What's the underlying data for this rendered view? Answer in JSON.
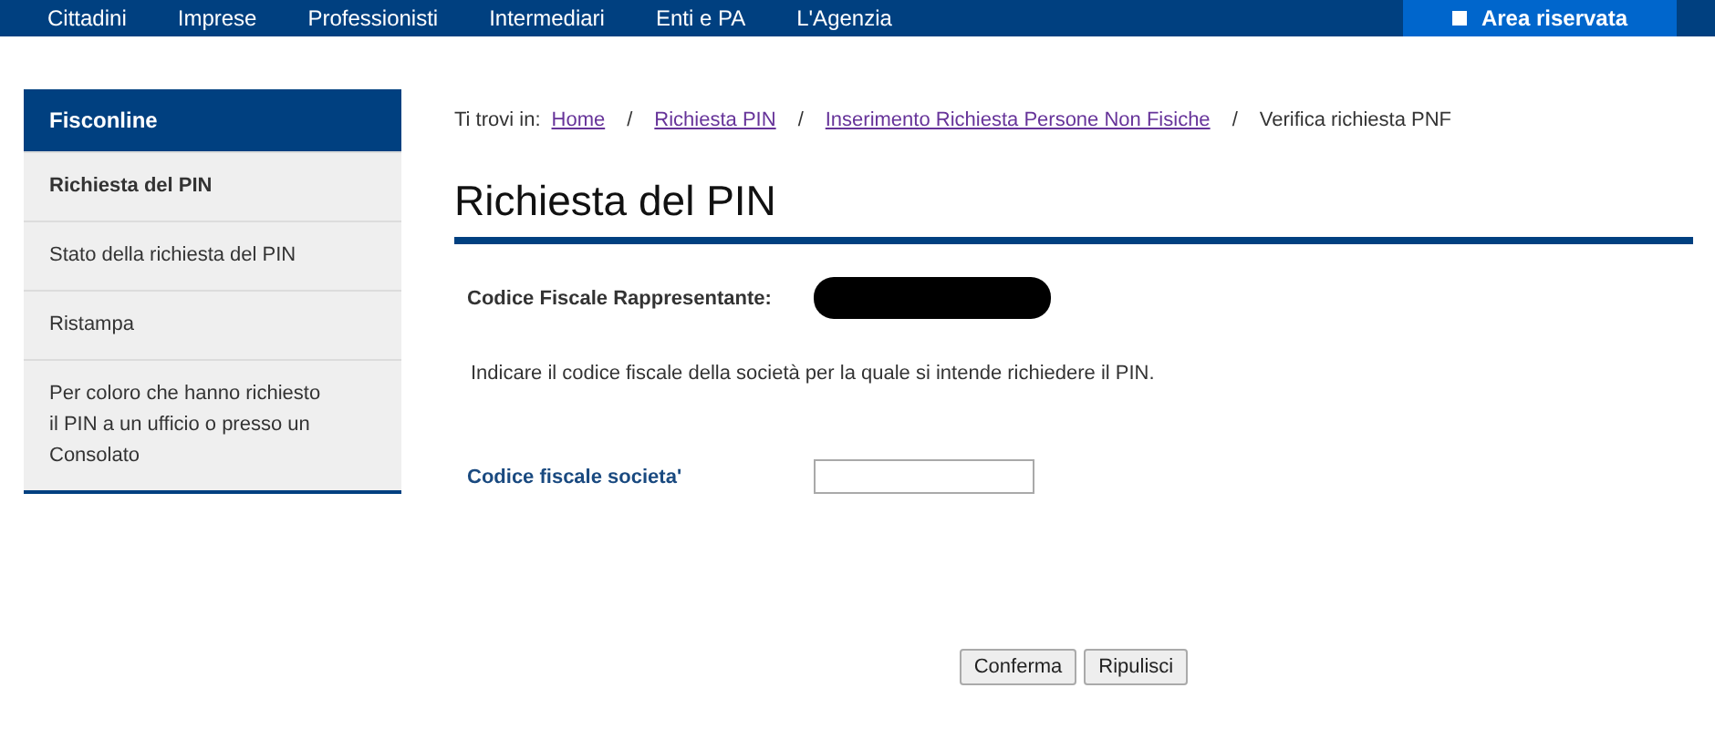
{
  "top_nav": {
    "items": [
      "Cittadini",
      "Imprese",
      "Professionisti",
      "Intermediari",
      "Enti e PA",
      "L'Agenzia"
    ],
    "reserved_button": "Area riservata"
  },
  "sidebar": {
    "title": "Fisconline",
    "items": [
      {
        "label": "Richiesta del PIN",
        "selected": true
      },
      {
        "label": "Stato della richiesta del PIN",
        "selected": false
      },
      {
        "label": "Ristampa",
        "selected": false
      },
      {
        "label": "Per coloro che hanno richiesto il PIN a un ufficio o presso un Consolato",
        "selected": false
      }
    ]
  },
  "breadcrumb": {
    "prefix": "Ti trovi in:",
    "links": [
      "Home",
      "Richiesta PIN",
      "Inserimento Richiesta Persone Non Fisiche"
    ],
    "separator": "/",
    "current": "Verifica richiesta PNF"
  },
  "page_title": "Richiesta del PIN",
  "representative": {
    "label": "Codice Fiscale Rappresentante:",
    "redacted": true
  },
  "instruction": "Indicare il codice fiscale della società per la quale si intende richiedere il PIN.",
  "company_field": {
    "label": "Codice fiscale societa'"
  },
  "buttons": [
    "Conferma",
    "Ripulisci"
  ]
}
